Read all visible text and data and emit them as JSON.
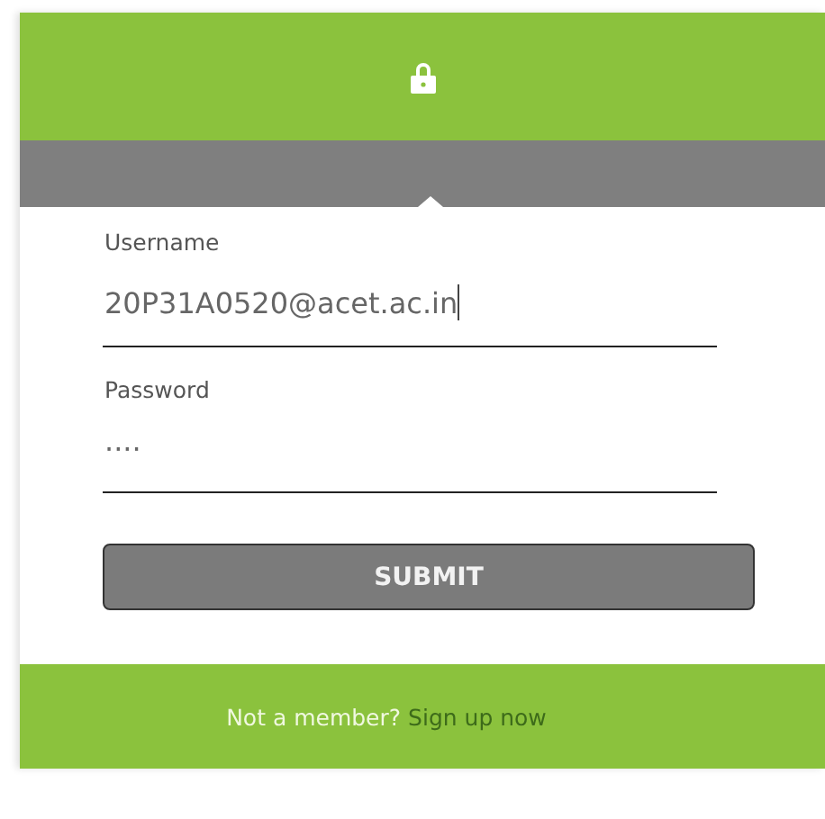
{
  "fields": [
    {
      "label": "Username",
      "value": "20P31A0520@acet.ac.in",
      "focused": true
    },
    {
      "label": "Password",
      "value": "····",
      "focused": false
    }
  ],
  "submit": {
    "label": "SUBMIT"
  },
  "footer": {
    "text": "Not a member?",
    "link": "Sign up now"
  }
}
